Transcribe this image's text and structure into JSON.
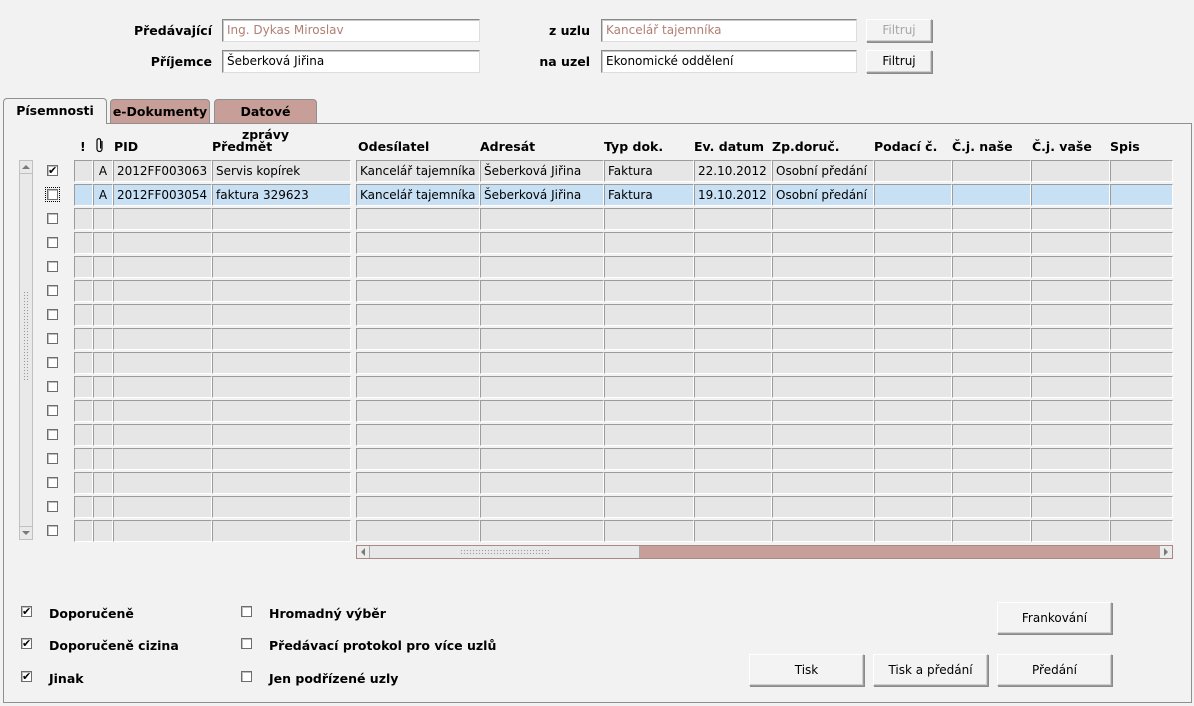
{
  "header": {
    "predavajici_label": "Předávající",
    "predavajici_value": "Ing. Dykas Miroslav",
    "z_uzlu_label": "z uzlu",
    "z_uzlu_value": "Kancelář tajemníka",
    "filter1_label": "Filtruj",
    "prijemce_label": "Příjemce",
    "prijemce_value": "Šeberková Jiřina",
    "na_uzel_label": "na uzel",
    "na_uzel_value": "Ekonomické oddělení",
    "filter2_label": "Filtruj"
  },
  "tabs": [
    {
      "label": "Písemnosti"
    },
    {
      "label": "e-Dokumenty"
    },
    {
      "label": "Datové zprávy"
    }
  ],
  "table": {
    "columns": {
      "excl": "!",
      "pid": "PID",
      "predmet": "Předmět",
      "odesilatel": "Odesílatel",
      "adresat": "Adresát",
      "typ": "Typ dok.",
      "ev_datum": "Ev. datum",
      "zp_doruc": "Zp.doruč.",
      "podaci": "Podací č.",
      "cj_nase": "Č.j. naše",
      "cj_vase": "Č.j. vaše",
      "spis": "Spis"
    },
    "rows": [
      {
        "checked": "✔",
        "flag": "A",
        "pid": "2012FF003063",
        "predmet": "Servis kopírek",
        "odesilatel": "Kancelář tajemníka",
        "adresat": "Šeberková Jiřina",
        "typ": "Faktura",
        "ev_datum": "22.10.2012",
        "zp_doruc": "Osobní předání"
      },
      {
        "checked": "",
        "flag": "A",
        "pid": "2012FF003054",
        "predmet": "faktura 329623",
        "odesilatel": "Kancelář tajemníka",
        "adresat": "Šeberková Jiřina",
        "typ": "Faktura",
        "ev_datum": "19.10.2012",
        "zp_doruc": "Osobní předání"
      }
    ],
    "empty_rows": 14
  },
  "options": {
    "doporucene": "Doporučeně",
    "doporucene_cizina": "Doporučeně cizina",
    "jinak": "Jinak",
    "hromadny_vyber": "Hromadný výběr",
    "predavaci_protokol": "Předávací protokol pro více uzlů",
    "jen_podrizene": "Jen podřízené uzly",
    "check_mark": "✔"
  },
  "buttons": {
    "frankovani": "Frankování",
    "tisk": "Tisk",
    "tisk_a_predani": "Tisk a předání",
    "predani": "Předání"
  },
  "colors": {
    "tab_inactive": "#c79f98",
    "row_selected": "#c8e0f4",
    "scrollbar": "#c79f98"
  }
}
